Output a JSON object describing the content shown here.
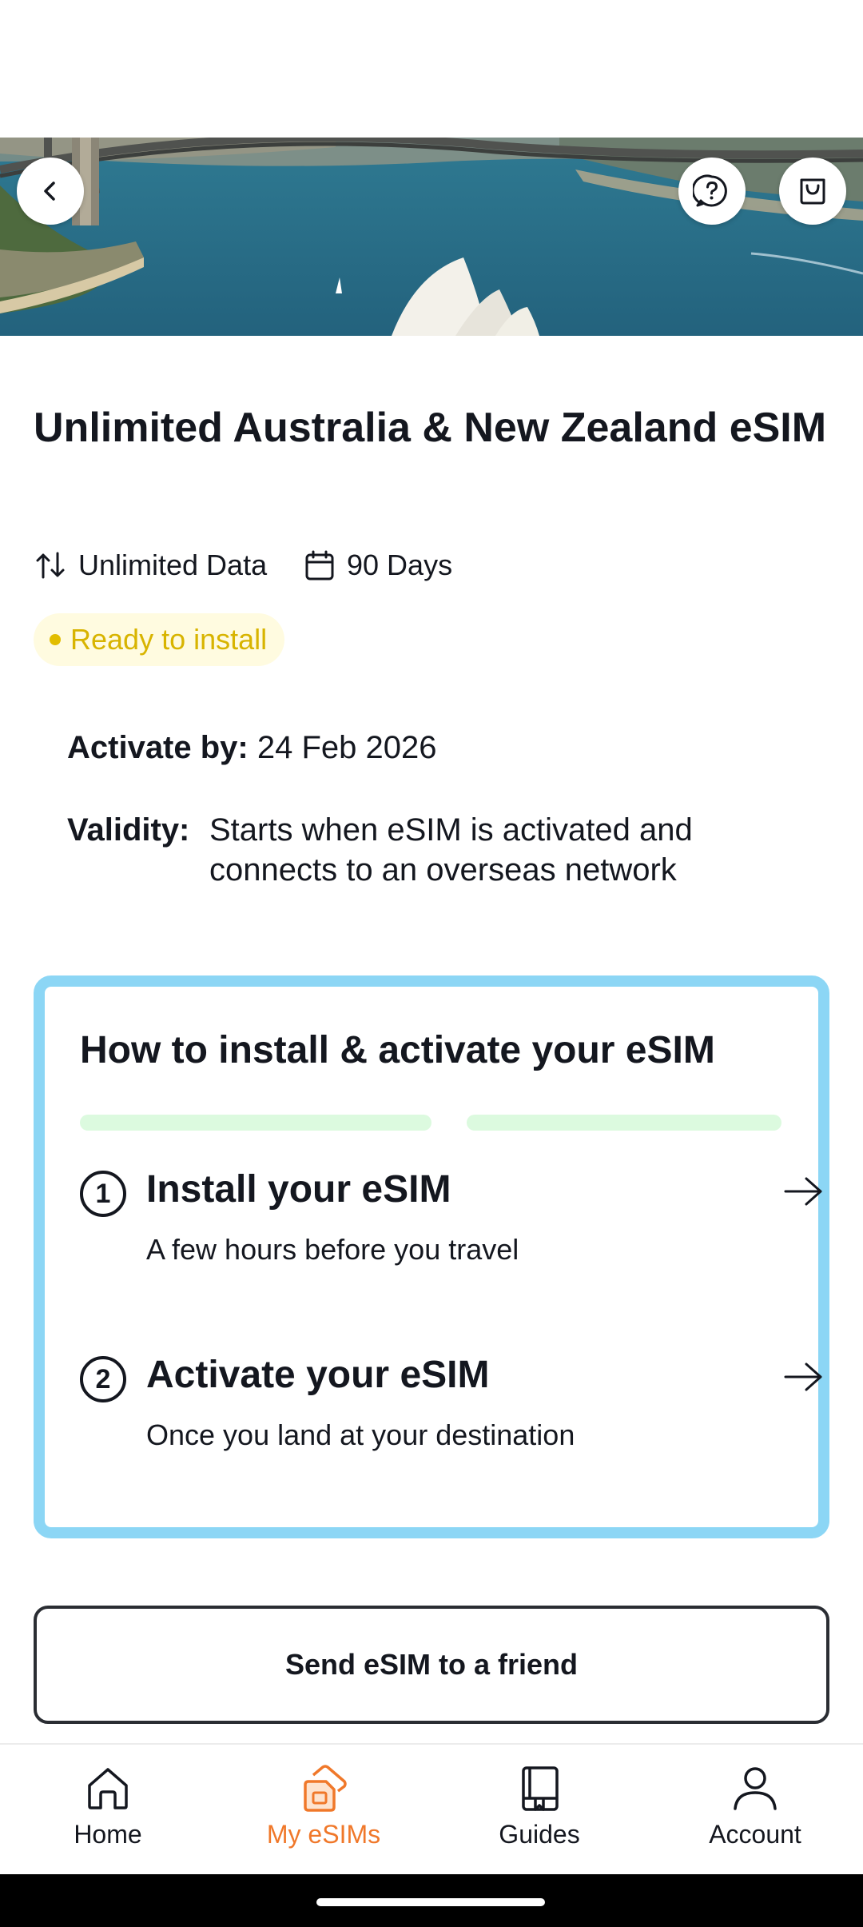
{
  "product": {
    "title": "Unlimited Australia & New Zealand eSIM",
    "data_label": "Unlimited Data",
    "duration_label": "90 Days",
    "status_badge": "Ready to install"
  },
  "details": {
    "activate_by_label": "Activate by:",
    "activate_by_value": "24 Feb 2026",
    "validity_label": "Validity:",
    "validity_value": "Starts when eSIM is activated and connects to an overseas network"
  },
  "install_card": {
    "title": "How to install & activate your eSIM",
    "steps": [
      {
        "number": "1",
        "title": "Install your eSIM",
        "subtitle": "A few hours before you travel"
      },
      {
        "number": "2",
        "title": "Activate your eSIM",
        "subtitle": "Once you land at your destination"
      }
    ]
  },
  "actions": {
    "send_to_friend": "Send eSIM to a friend"
  },
  "nav": {
    "items": [
      {
        "label": "Home",
        "icon": "home-icon",
        "active": false
      },
      {
        "label": "My eSIMs",
        "icon": "esim-icon",
        "active": true
      },
      {
        "label": "Guides",
        "icon": "book-icon",
        "active": false
      },
      {
        "label": "Account",
        "icon": "person-icon",
        "active": false
      }
    ]
  },
  "colors": {
    "accent": "#f0782a",
    "card_border": "#8cd6f5",
    "badge_text": "#d8b400",
    "badge_bg": "#fffbe0",
    "progress": "#dcfadf"
  }
}
